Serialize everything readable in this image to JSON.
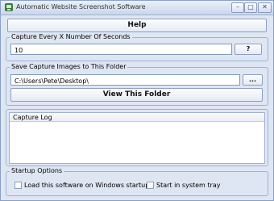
{
  "window": {
    "title": "Automatic Website Screenshot Software",
    "minimize_glyph": "–",
    "maximize_glyph": "□",
    "close_glyph": "✕"
  },
  "help_label": "Help",
  "capture_interval": {
    "label": "Capture Every X Number Of Seconds",
    "value": "10",
    "help_button": "?"
  },
  "save_folder": {
    "label": "Save Capture Images to This Folder",
    "value": "C:\\Users\\Pete\\Desktop\\",
    "browse_button": "...",
    "view_button": "View This Folder"
  },
  "capture_log": {
    "header": "Capture Log",
    "entries": []
  },
  "startup": {
    "label": "Startup Options",
    "load_on_startup": {
      "label": "Load this software on Windows startup",
      "checked": false
    },
    "start_in_tray": {
      "label": "Start in system tray",
      "checked": false
    }
  }
}
